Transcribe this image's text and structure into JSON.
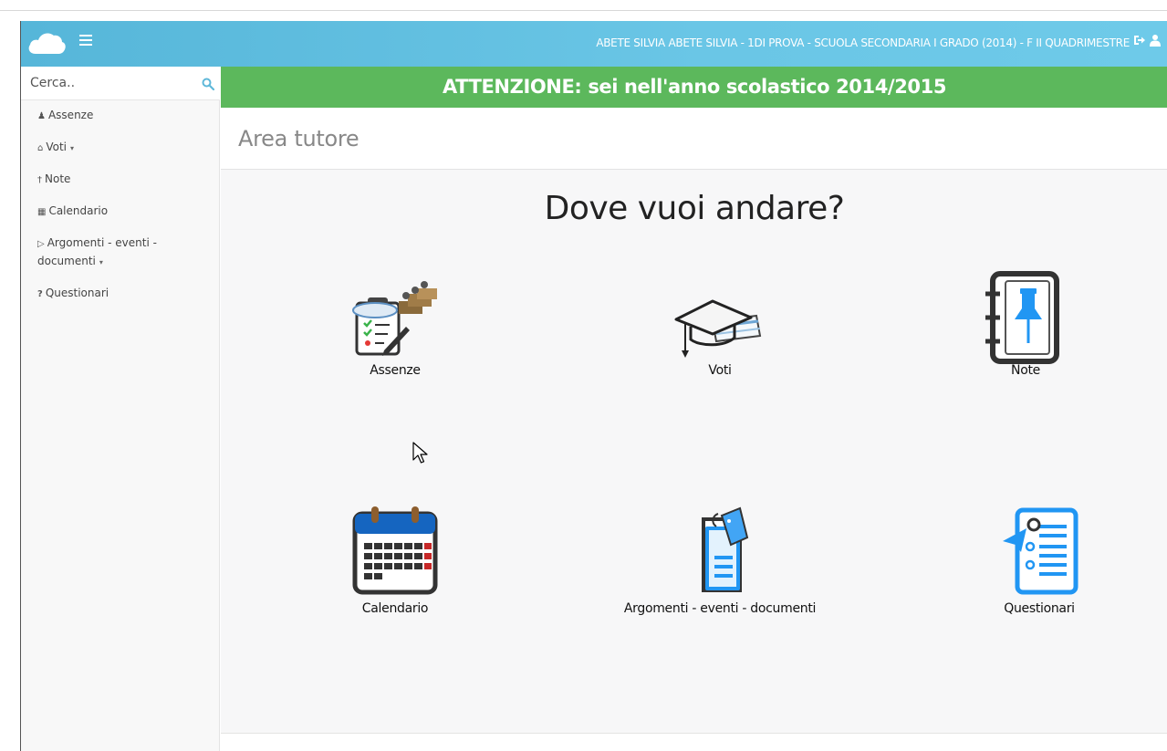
{
  "navbar": {
    "user_info": "ABETE SILVIA  ABETE SILVIA - 1DI PROVA - SCUOLA SECONDARIA I GRADO (2014) - F  II QUADRIMESTRE",
    "brand_icon": "cloud-icon",
    "menu_icon": "hamburger-icon",
    "logout_icon": "sign-out-icon",
    "user_icon": "user-icon"
  },
  "sidebar": {
    "search_placeholder": "Cerca..",
    "search_icon": "search-icon",
    "items": [
      {
        "label": "Assenze",
        "icon": "user-icon",
        "glyph": "♟",
        "caret": ""
      },
      {
        "label": "Voti",
        "icon": "bank-icon",
        "glyph": "⌂",
        "caret": "▾"
      },
      {
        "label": "Note",
        "icon": "pushpin-icon",
        "glyph": "†",
        "caret": ""
      },
      {
        "label": "Calendario",
        "icon": "calendar-icon",
        "glyph": "▦",
        "caret": ""
      },
      {
        "label": "Argomenti - eventi - documenti",
        "icon": "folder-open-icon",
        "glyph": "▷",
        "caret": "▾"
      },
      {
        "label": "Questionari",
        "icon": "question-icon",
        "glyph": "?",
        "caret": ""
      }
    ]
  },
  "alert": {
    "text": "ATTENZIONE: sei nell'anno scolastico 2014/2015",
    "color": "#5cb85c"
  },
  "main": {
    "page_title": "Area tutore",
    "question": "Dove vuoi andare?",
    "tiles": [
      {
        "label": "Assenze",
        "icon": "attendance-clipboard-icon"
      },
      {
        "label": "Voti",
        "icon": "graduation-cap-icon"
      },
      {
        "label": "Note",
        "icon": "notebook-pushpin-icon"
      },
      {
        "label": "Calendario",
        "icon": "calendar-icon"
      },
      {
        "label": "Argomenti - eventi - documenti",
        "icon": "documents-event-icon"
      },
      {
        "label": "Questionari",
        "icon": "questionnaire-icon"
      }
    ]
  },
  "colors": {
    "navbar": "#6ac6e6",
    "alert": "#5cb85c",
    "accent_blue": "#2196f3"
  }
}
